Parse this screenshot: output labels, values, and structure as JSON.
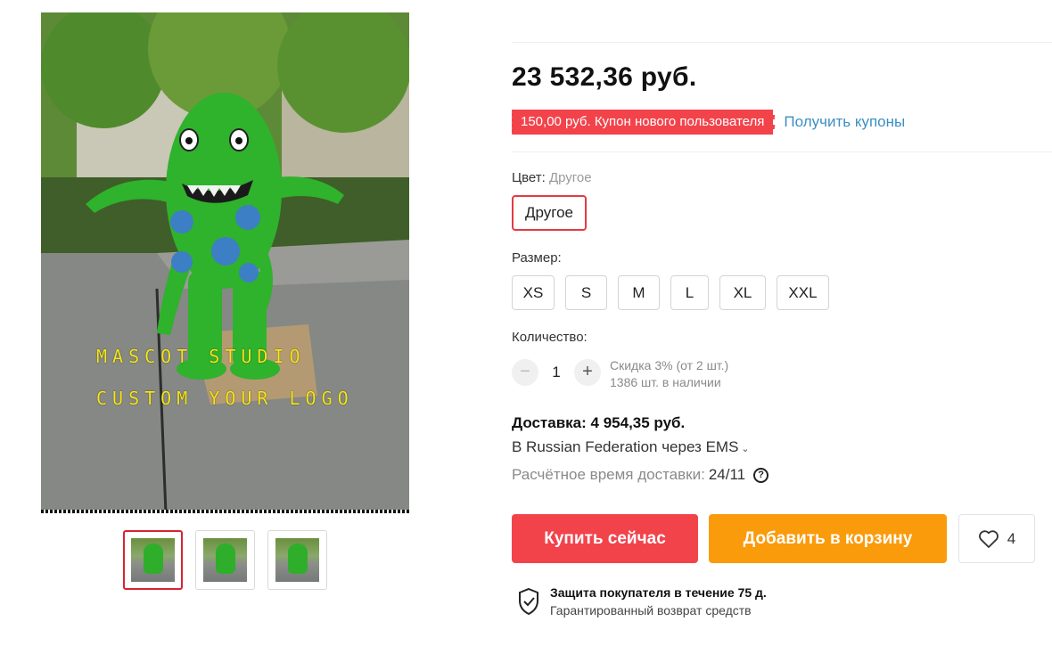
{
  "gallery": {
    "main_overlay_line1": "MASCOT STUDIO",
    "main_overlay_line2": "CUSTOM YOUR LOGO",
    "thumbnails_count": 3,
    "active_thumbnail": 1
  },
  "product": {
    "price": "23 532,36 руб.",
    "coupon_text": "150,00 руб. Купон нового пользователя",
    "coupon_link": "Получить купоны",
    "color_label": "Цвет:",
    "color_selected": "Другое",
    "color_option": "Другое",
    "size_label": "Размер:",
    "sizes": [
      "XS",
      "S",
      "M",
      "L",
      "XL",
      "XXL"
    ],
    "quantity_label": "Количество:",
    "quantity_minus": "−",
    "quantity_value": "1",
    "quantity_plus": "+",
    "discount_text": "Скидка 3% (от 2 шт.)",
    "stock_text": "1386 шт. в наличии"
  },
  "shipping": {
    "cost_label": "Доставка:",
    "cost_value": "4 954,35 руб.",
    "route": "В Russian Federation через EMS",
    "time_label": "Расчётное время доставки:",
    "time_value": "24/11"
  },
  "actions": {
    "buy_now": "Купить сейчас",
    "add_to_cart": "Добавить в корзину",
    "wishlist_count": "4"
  },
  "protection": {
    "title": "Защита покупателя в течение 75 д.",
    "subtitle": "Гарантированный возврат средств"
  },
  "colors": {
    "accent_red": "#f2434b",
    "accent_orange": "#fa9b0c",
    "link_blue": "#3b8fc4"
  }
}
